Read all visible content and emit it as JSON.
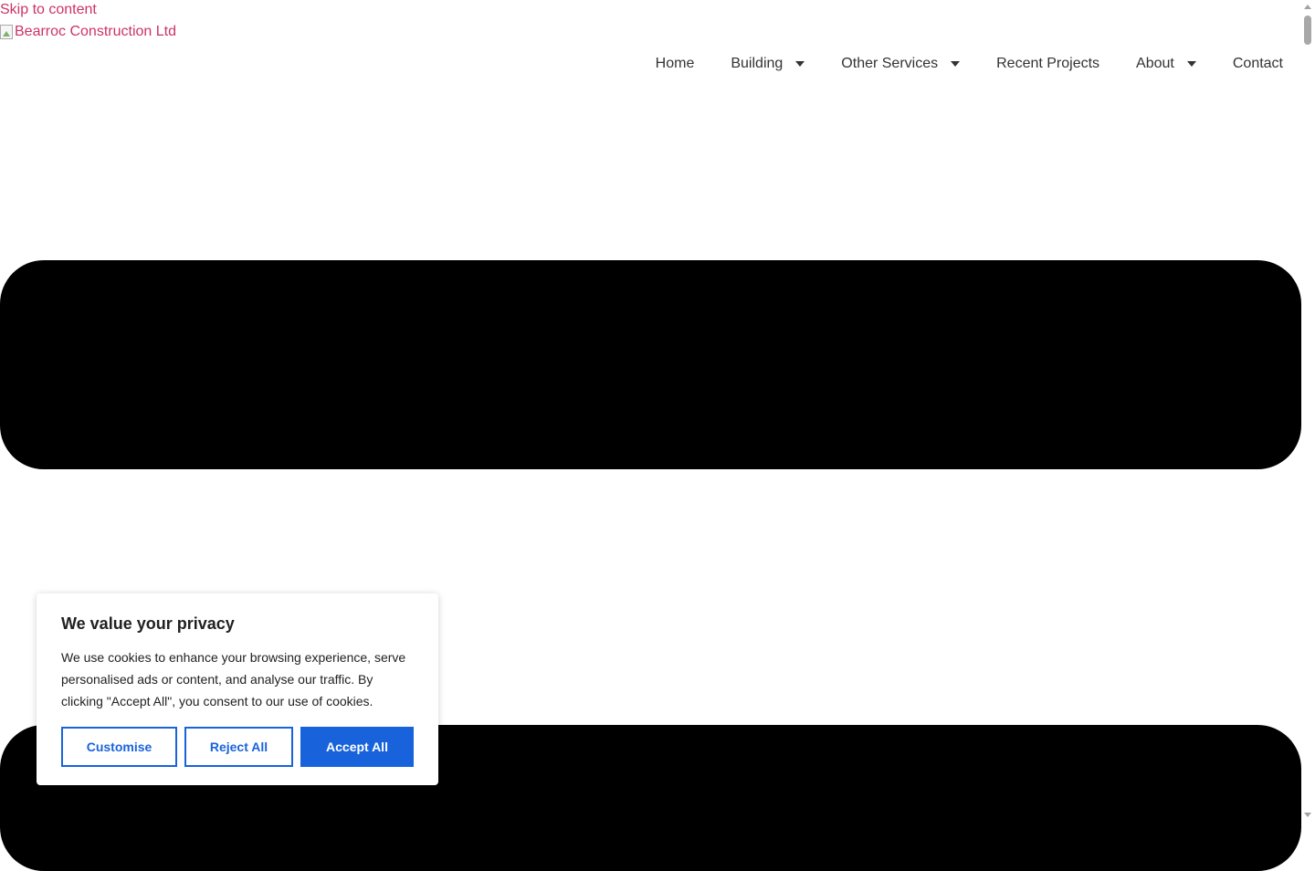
{
  "skip_link": "Skip to content",
  "logo_alt": "Bearroc Construction Ltd",
  "nav": {
    "items": [
      {
        "label": "Home",
        "has_dropdown": false
      },
      {
        "label": "Building",
        "has_dropdown": true
      },
      {
        "label": "Other Services",
        "has_dropdown": true
      },
      {
        "label": "Recent Projects",
        "has_dropdown": false
      },
      {
        "label": "About",
        "has_dropdown": true
      },
      {
        "label": "Contact",
        "has_dropdown": false
      }
    ]
  },
  "cookie": {
    "title": "We value your privacy",
    "text": "We use cookies to enhance your browsing experience, serve personalised ads or content, and analyse our traffic. By clicking \"Accept All\", you consent to our use of cookies.",
    "customise_label": "Customise",
    "reject_label": "Reject All",
    "accept_label": "Accept All"
  },
  "colors": {
    "link": "#cc3366",
    "accent": "#1863dc",
    "text": "#212121"
  }
}
